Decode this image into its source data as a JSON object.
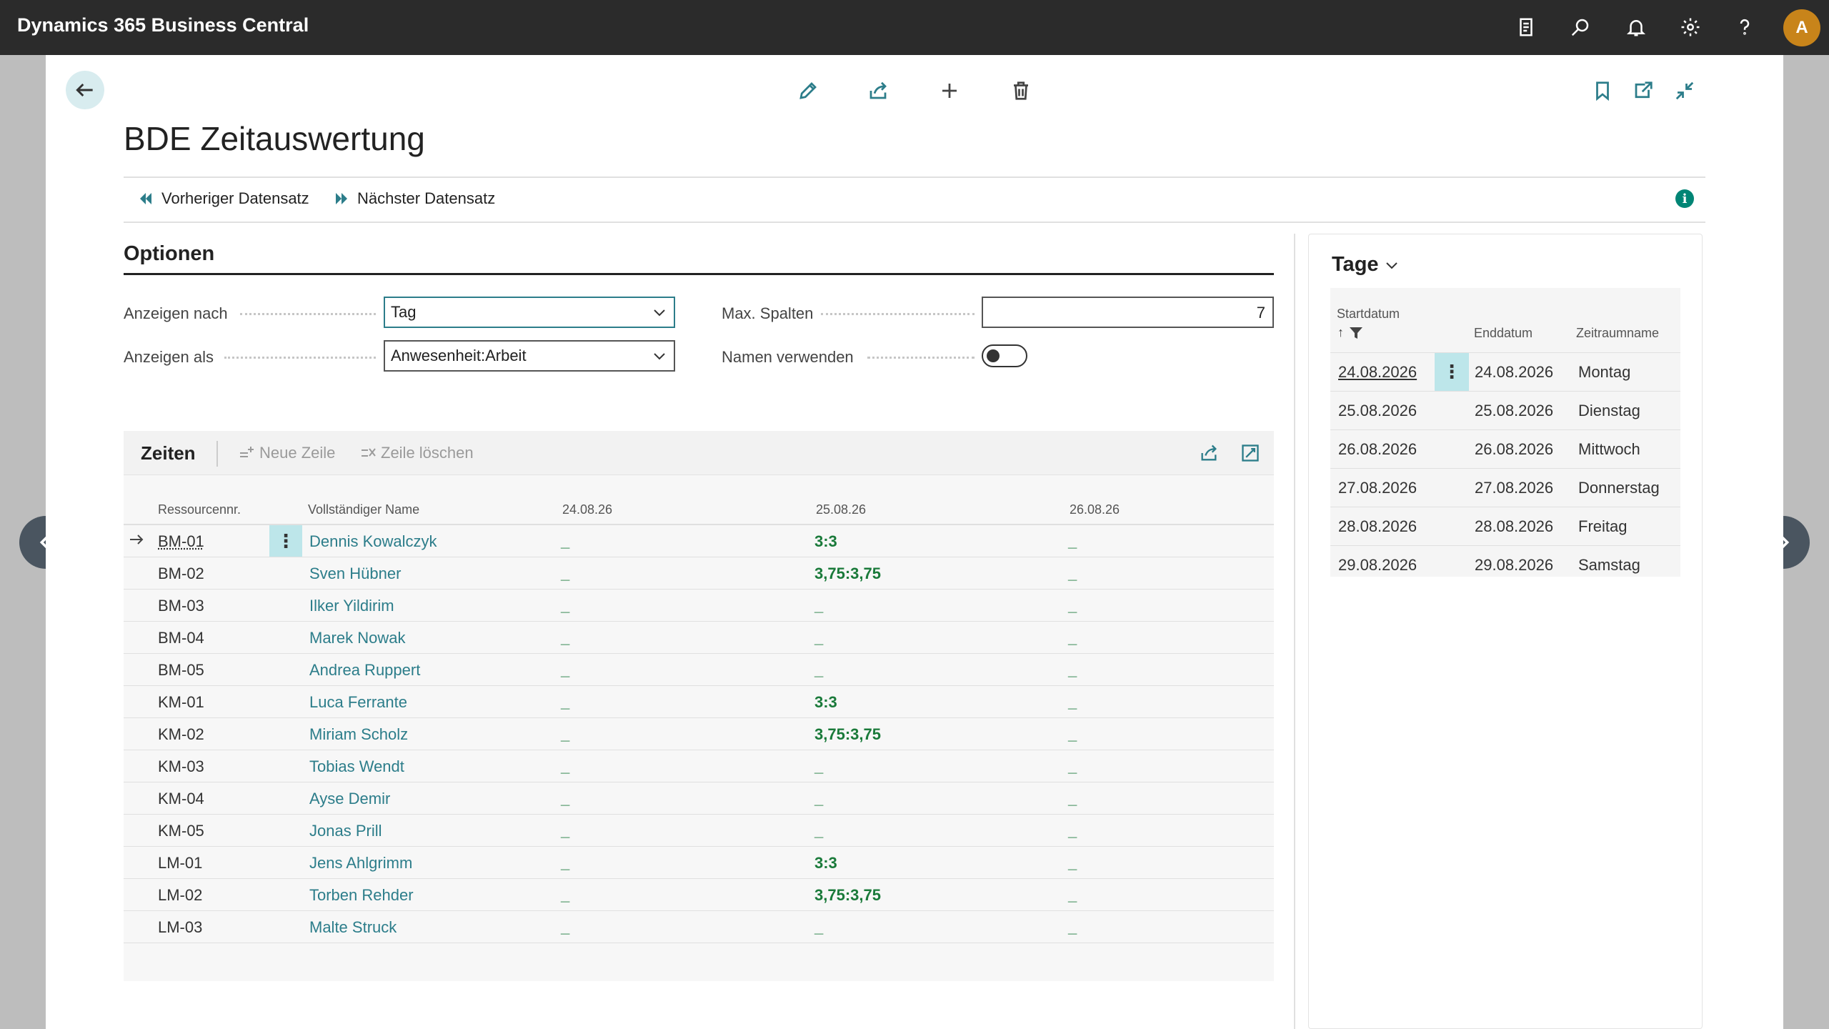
{
  "app": {
    "title": "Dynamics 365 Business Central",
    "avatar_initial": "A"
  },
  "topbar_icons": [
    "document-icon",
    "search-icon",
    "bell-icon",
    "gear-icon",
    "help-icon"
  ],
  "page": {
    "title": "BDE Zeitauswertung",
    "prev_record": "Vorheriger Datensatz",
    "next_record": "Nächster Datensatz",
    "info": "i"
  },
  "options": {
    "section_title": "Optionen",
    "show_by_label": "Anzeigen nach",
    "show_by_value": "Tag",
    "show_as_label": "Anzeigen als",
    "show_as_value": "Anwesenheit:Arbeit",
    "max_columns_label": "Max. Spalten",
    "max_columns_value": "7",
    "use_names_label": "Namen verwenden",
    "use_names_value": false
  },
  "zeiten": {
    "title": "Zeiten",
    "new_line": "Neue Zeile",
    "delete_line": "Zeile löschen",
    "columns": [
      "Ressourcennr.",
      "Vollständiger Name",
      "24.08.26",
      "25.08.26",
      "26.08.26"
    ],
    "rows": [
      {
        "id": "BM-01",
        "name": "Dennis Kowalczyk",
        "c1": "_",
        "c2": "3:3",
        "c3": "_"
      },
      {
        "id": "BM-02",
        "name": "Sven Hübner",
        "c1": "_",
        "c2": "3,75:3,75",
        "c3": "_"
      },
      {
        "id": "BM-03",
        "name": "Ilker Yildirim",
        "c1": "_",
        "c2": "_",
        "c3": "_"
      },
      {
        "id": "BM-04",
        "name": "Marek Nowak",
        "c1": "_",
        "c2": "_",
        "c3": "_"
      },
      {
        "id": "BM-05",
        "name": "Andrea Ruppert",
        "c1": "_",
        "c2": "_",
        "c3": "_"
      },
      {
        "id": "KM-01",
        "name": "Luca Ferrante",
        "c1": "_",
        "c2": "3:3",
        "c3": "_"
      },
      {
        "id": "KM-02",
        "name": "Miriam Scholz",
        "c1": "_",
        "c2": "3,75:3,75",
        "c3": "_"
      },
      {
        "id": "KM-03",
        "name": "Tobias Wendt",
        "c1": "_",
        "c2": "_",
        "c3": "_"
      },
      {
        "id": "KM-04",
        "name": "Ayse Demir",
        "c1": "_",
        "c2": "_",
        "c3": "_"
      },
      {
        "id": "KM-05",
        "name": "Jonas Prill",
        "c1": "_",
        "c2": "_",
        "c3": "_"
      },
      {
        "id": "LM-01",
        "name": "Jens Ahlgrimm",
        "c1": "_",
        "c2": "3:3",
        "c3": "_"
      },
      {
        "id": "LM-02",
        "name": "Torben Rehder",
        "c1": "_",
        "c2": "3,75:3,75",
        "c3": "_"
      },
      {
        "id": "LM-03",
        "name": "Malte Struck",
        "c1": "_",
        "c2": "_",
        "c3": "_"
      }
    ]
  },
  "tage": {
    "title": "Tage",
    "columns": [
      "Startdatum",
      "Enddatum",
      "Zeitraumname"
    ],
    "rows": [
      {
        "start": "24.08.2026",
        "end": "24.08.2026",
        "name": "Montag"
      },
      {
        "start": "25.08.2026",
        "end": "25.08.2026",
        "name": "Dienstag"
      },
      {
        "start": "26.08.2026",
        "end": "26.08.2026",
        "name": "Mittwoch"
      },
      {
        "start": "27.08.2026",
        "end": "27.08.2026",
        "name": "Donnerstag"
      },
      {
        "start": "28.08.2026",
        "end": "28.08.2026",
        "name": "Freitag"
      },
      {
        "start": "29.08.2026",
        "end": "29.08.2026",
        "name": "Samstag"
      }
    ]
  }
}
